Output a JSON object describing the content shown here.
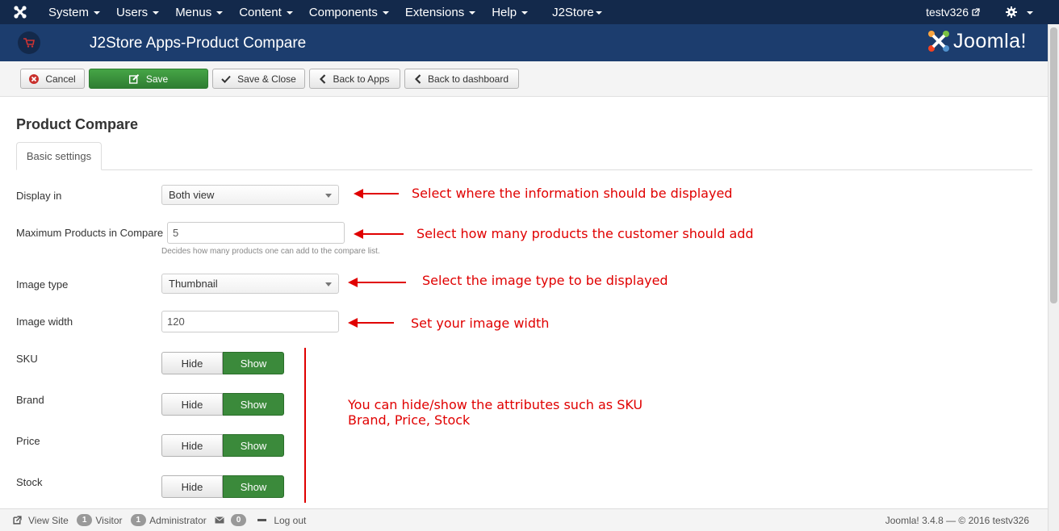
{
  "navbar": {
    "menu": [
      {
        "label": "System",
        "caret": true
      },
      {
        "label": "Users",
        "caret": true
      },
      {
        "label": "Menus",
        "caret": true
      },
      {
        "label": "Content",
        "caret": true
      },
      {
        "label": "Components",
        "caret": true
      },
      {
        "label": "Extensions",
        "caret": true
      },
      {
        "label": "Help",
        "caret": true
      },
      {
        "label": "J2Store",
        "caret": true
      }
    ],
    "user": "testv326"
  },
  "header": {
    "title": "J2Store Apps-Product Compare",
    "brand": "Joomla!"
  },
  "toolbar": {
    "cancel": "Cancel",
    "save": "Save",
    "save_close": "Save & Close",
    "back_apps": "Back to Apps",
    "back_dashboard": "Back to dashboard"
  },
  "page": {
    "title": "Product Compare",
    "tab": "Basic settings"
  },
  "form": {
    "display_in": {
      "label": "Display in",
      "value": "Both view"
    },
    "max_products": {
      "label": "Maximum Products in Compare",
      "value": "5",
      "help": "Decides how many products one can add to the compare list."
    },
    "image_type": {
      "label": "Image type",
      "value": "Thumbnail"
    },
    "image_width": {
      "label": "Image width",
      "value": "120"
    },
    "toggles": [
      {
        "label": "SKU",
        "hide": "Hide",
        "show": "Show",
        "selected": "Show"
      },
      {
        "label": "Brand",
        "hide": "Hide",
        "show": "Show",
        "selected": "Show"
      },
      {
        "label": "Price",
        "hide": "Hide",
        "show": "Show",
        "selected": "Show"
      },
      {
        "label": "Stock",
        "hide": "Hide",
        "show": "Show",
        "selected": "Show"
      }
    ]
  },
  "annotations": {
    "display": "Select where the information should be displayed",
    "max": "Select how many products the customer should add",
    "image_type": "Select the image type to be displayed",
    "image_width": "Set your image width",
    "attributes_line1": "You can hide/show the attributes such as SKU",
    "attributes_line2": "Brand, Price, Stock"
  },
  "footer": {
    "view_site": "View Site",
    "visitor_count": "1",
    "visitor": "Visitor",
    "admin_count": "1",
    "admin": "Administrator",
    "messages_count": "0",
    "logout": "Log out",
    "version": "Joomla! 3.4.8 — © 2016 testv326"
  },
  "colors": {
    "navbar": "#13294b",
    "header": "#1c3d6e",
    "save_green": "#3b8a3b",
    "annotation_red": "#e00000"
  }
}
